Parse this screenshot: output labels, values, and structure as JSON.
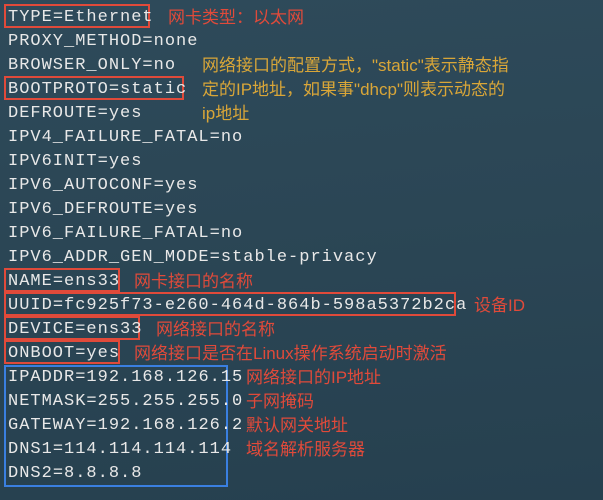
{
  "lines": [
    {
      "k": "TYPE",
      "v": "Ethernet"
    },
    {
      "k": "PROXY_METHOD",
      "v": "none"
    },
    {
      "k": "BROWSER_ONLY",
      "v": "no"
    },
    {
      "k": "BOOTPROTO",
      "v": "static"
    },
    {
      "k": "DEFROUTE",
      "v": "yes"
    },
    {
      "k": "IPV4_FAILURE_FATAL",
      "v": "no"
    },
    {
      "k": "IPV6INIT",
      "v": "yes"
    },
    {
      "k": "IPV6_AUTOCONF",
      "v": "yes"
    },
    {
      "k": "IPV6_DEFROUTE",
      "v": "yes"
    },
    {
      "k": "IPV6_FAILURE_FATAL",
      "v": "no"
    },
    {
      "k": "IPV6_ADDR_GEN_MODE",
      "v": "stable-privacy"
    },
    {
      "k": "NAME",
      "v": "ens33"
    },
    {
      "k": "UUID",
      "v": "fc925f73-e260-464d-864b-598a5372b2ca"
    },
    {
      "k": "DEVICE",
      "v": "ens33"
    },
    {
      "k": "ONBOOT",
      "v": "yes"
    },
    {
      "k": "IPADDR",
      "v": "192.168.126.15"
    },
    {
      "k": "NETMASK",
      "v": "255.255.255.0"
    },
    {
      "k": "GATEWAY",
      "v": "192.168.126.2"
    },
    {
      "k": "DNS1",
      "v": "114.114.114.114"
    },
    {
      "k": "DNS2",
      "v": "8.8.8.8"
    }
  ],
  "annotations": {
    "type_note": "网卡类型：以太网",
    "bootproto_note": "网络接口的配置方式，\"static\"表示静态指定的IP地址，如果事\"dhcp\"则表示动态的ip地址",
    "bootproto_l1": "网络接口的配置方式，\"static\"表示静态指",
    "bootproto_l2": "定的IP地址，如果事\"dhcp\"则表示动态的",
    "bootproto_l3": "ip地址",
    "name_note": "网卡接口的名称",
    "uuid_note": "设备ID",
    "device_note": "网络接口的名称",
    "onboot_note": "网络接口是否在Linux操作系统启动时激活",
    "ipaddr_note": "网络接口的IP地址",
    "netmask_note": "子网掩码",
    "gateway_note": "默认网关地址",
    "dns_note": "域名解析服务器"
  }
}
